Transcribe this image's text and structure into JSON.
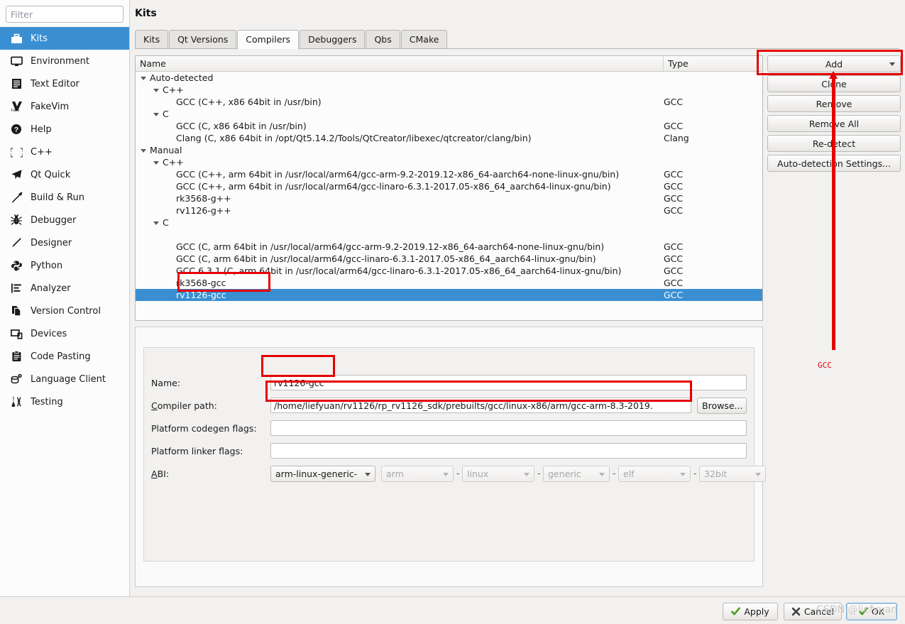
{
  "sidebar": {
    "filter_placeholder": "Filter",
    "items": [
      {
        "label": "Kits",
        "icon": "kits-icon",
        "selected": true
      },
      {
        "label": "Environment",
        "icon": "monitor-icon",
        "selected": false
      },
      {
        "label": "Text Editor",
        "icon": "document-lines-icon",
        "selected": false
      },
      {
        "label": "FakeVim",
        "icon": "fakevim-icon",
        "selected": false
      },
      {
        "label": "Help",
        "icon": "question-mark-icon",
        "selected": false
      },
      {
        "label": "C++",
        "icon": "braces-icon",
        "selected": false
      },
      {
        "label": "Qt Quick",
        "icon": "paper-plane-icon",
        "selected": false
      },
      {
        "label": "Build & Run",
        "icon": "hammer-icon",
        "selected": false
      },
      {
        "label": "Debugger",
        "icon": "bug-icon",
        "selected": false
      },
      {
        "label": "Designer",
        "icon": "pencil-icon",
        "selected": false
      },
      {
        "label": "Python",
        "icon": "python-snake-icon",
        "selected": false
      },
      {
        "label": "Analyzer",
        "icon": "bar-list-icon",
        "selected": false
      },
      {
        "label": "Version Control",
        "icon": "copy-pages-icon",
        "selected": false
      },
      {
        "label": "Devices",
        "icon": "devices-icon",
        "selected": false
      },
      {
        "label": "Code Pasting",
        "icon": "clipboard-icon",
        "selected": false
      },
      {
        "label": "Language Client",
        "icon": "database-gear-icon",
        "selected": false
      },
      {
        "label": "Testing",
        "icon": "flask-icon",
        "selected": false
      }
    ]
  },
  "header": {
    "title": "Kits"
  },
  "tabs": [
    {
      "label": "Kits",
      "active": false
    },
    {
      "label": "Qt Versions",
      "active": false
    },
    {
      "label": "Compilers",
      "active": true
    },
    {
      "label": "Debuggers",
      "active": false
    },
    {
      "label": "Qbs",
      "active": false
    },
    {
      "label": "CMake",
      "active": false
    }
  ],
  "tree": {
    "columns": [
      "Name",
      "Type"
    ],
    "rows": [
      {
        "depth": 0,
        "expander": true,
        "name": "Auto-detected",
        "type": "",
        "selected": false
      },
      {
        "depth": 1,
        "expander": true,
        "name": "C++",
        "type": "",
        "selected": false
      },
      {
        "depth": 2,
        "expander": false,
        "name": "GCC (C++, x86 64bit in /usr/bin)",
        "type": "GCC",
        "selected": false
      },
      {
        "depth": 1,
        "expander": true,
        "name": "C",
        "type": "",
        "selected": false
      },
      {
        "depth": 2,
        "expander": false,
        "name": "GCC (C, x86 64bit in /usr/bin)",
        "type": "GCC",
        "selected": false
      },
      {
        "depth": 2,
        "expander": false,
        "name": "Clang (C, x86 64bit in /opt/Qt5.14.2/Tools/QtCreator/libexec/qtcreator/clang/bin)",
        "type": "Clang",
        "selected": false
      },
      {
        "depth": 0,
        "expander": true,
        "name": "Manual",
        "type": "",
        "selected": false
      },
      {
        "depth": 1,
        "expander": true,
        "name": "C++",
        "type": "",
        "selected": false
      },
      {
        "depth": 2,
        "expander": false,
        "name": "GCC (C++, arm 64bit in /usr/local/arm64/gcc-arm-9.2-2019.12-x86_64-aarch64-none-linux-gnu/bin)",
        "type": "GCC",
        "selected": false
      },
      {
        "depth": 2,
        "expander": false,
        "name": "GCC (C++, arm 64bit in /usr/local/arm64/gcc-linaro-6.3.1-2017.05-x86_64_aarch64-linux-gnu/bin)",
        "type": "GCC",
        "selected": false
      },
      {
        "depth": 2,
        "expander": false,
        "name": "rk3568-g++",
        "type": "GCC",
        "selected": false
      },
      {
        "depth": 2,
        "expander": false,
        "name": "rv1126-g++",
        "type": "GCC",
        "selected": false
      },
      {
        "depth": 1,
        "expander": true,
        "name": "C",
        "type": "",
        "selected": false
      },
      {
        "depth": 2,
        "expander": false,
        "name": "",
        "type": "",
        "selected": false
      },
      {
        "depth": 2,
        "expander": false,
        "name": "GCC (C, arm 64bit in /usr/local/arm64/gcc-arm-9.2-2019.12-x86_64-aarch64-none-linux-gnu/bin)",
        "type": "GCC",
        "selected": false
      },
      {
        "depth": 2,
        "expander": false,
        "name": "GCC (C, arm 64bit in /usr/local/arm64/gcc-linaro-6.3.1-2017.05-x86_64_aarch64-linux-gnu/bin)",
        "type": "GCC",
        "selected": false
      },
      {
        "depth": 2,
        "expander": false,
        "name": "GCC 6.3.1 (C, arm 64bit in /usr/local/arm64/gcc-linaro-6.3.1-2017.05-x86_64_aarch64-linux-gnu/bin)",
        "type": "GCC",
        "selected": false
      },
      {
        "depth": 2,
        "expander": false,
        "name": "rk3568-gcc",
        "type": "GCC",
        "selected": false
      },
      {
        "depth": 2,
        "expander": false,
        "name": "rv1126-gcc",
        "type": "GCC",
        "selected": true
      }
    ]
  },
  "side_buttons": [
    {
      "label": "Add",
      "has_dropdown": true
    },
    {
      "label": "Clone",
      "has_dropdown": false
    },
    {
      "label": "Remove",
      "has_dropdown": false
    },
    {
      "label": "Remove All",
      "has_dropdown": false
    },
    {
      "label": "Re-detect",
      "has_dropdown": false
    },
    {
      "label": "Auto-detection Settings...",
      "has_dropdown": false
    }
  ],
  "form": {
    "name_label": "Name:",
    "name_value": "rv1126-gcc",
    "compiler_path_label": "Compiler path:",
    "compiler_path_value": "/home/liefyuan/rv1126/rp_rv1126_sdk/prebuilts/gcc/linux-x86/arm/gcc-arm-8.3-2019.",
    "browse_label": "Browse...",
    "codegen_label": "Platform codegen flags:",
    "codegen_value": "",
    "linker_label": "Platform linker flags:",
    "linker_value": "",
    "abi_label": "ABI:",
    "abi_main": "arm-linux-generic-",
    "abi_parts": [
      "arm",
      "linux",
      "generic",
      "elf",
      "32bit"
    ],
    "abi_separator": "-"
  },
  "dialog_buttons": [
    {
      "label": "Apply",
      "icon": "check-icon",
      "default": false
    },
    {
      "label": "Cancel",
      "icon": "cross-icon",
      "default": false
    },
    {
      "label": "OK",
      "icon": "check-icon",
      "default": true
    }
  ],
  "annotations": {
    "arrow_note": "GCC",
    "watermark": "CSDN @liefyuan"
  },
  "colors": {
    "selection_blue": "#3a8fd2",
    "annotation_red": "#e60000",
    "window_bg": "#f2f1f0",
    "panel_bg": "#fcfcfc"
  }
}
